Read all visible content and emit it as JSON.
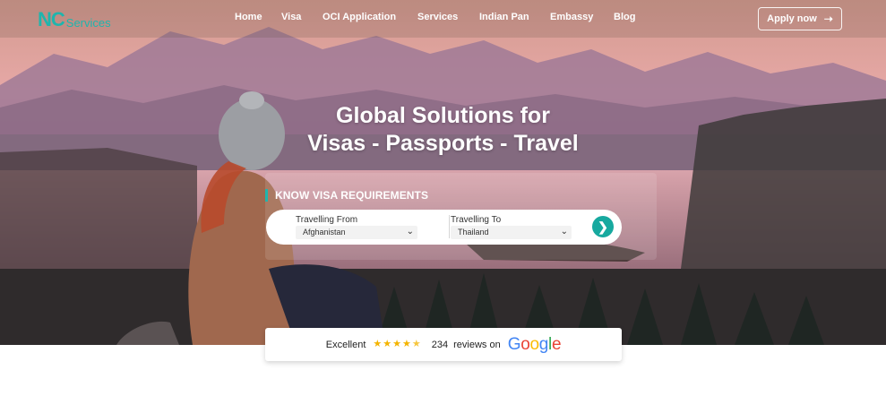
{
  "brand": {
    "mark": "NC",
    "name": "Services"
  },
  "nav": {
    "items": [
      {
        "label": "Home"
      },
      {
        "label": "Visa"
      },
      {
        "label": "OCI Application"
      },
      {
        "label": "Services"
      },
      {
        "label": "Indian Pan"
      },
      {
        "label": "Embassy"
      },
      {
        "label": "Blog"
      }
    ],
    "apply_label": "Apply now"
  },
  "hero": {
    "line1": "Global Solutions for",
    "line2": "Visas - Passports - Travel"
  },
  "visa_search": {
    "heading": "KNOW VISA REQUIREMENTS",
    "from_label": "Travelling From",
    "from_value": "Afghanistan",
    "to_label": "Travelling To",
    "to_value": "Thailand"
  },
  "reviews": {
    "rating_text": "Excellent",
    "rating": 4.5,
    "count": "234",
    "suffix": "reviews on",
    "provider": "Google"
  },
  "icons": {
    "apply": "arrow-right-icon",
    "go": "chevron-right-icon",
    "select": "chevron-down-icon",
    "star": "star-icon"
  },
  "colors": {
    "accent": "#1fb5ad",
    "go_button": "#17a99f",
    "star": "#f4b400",
    "google_blue": "#4285F4",
    "google_red": "#EA4335",
    "google_yellow": "#FBBC05",
    "google_green": "#34A853"
  }
}
